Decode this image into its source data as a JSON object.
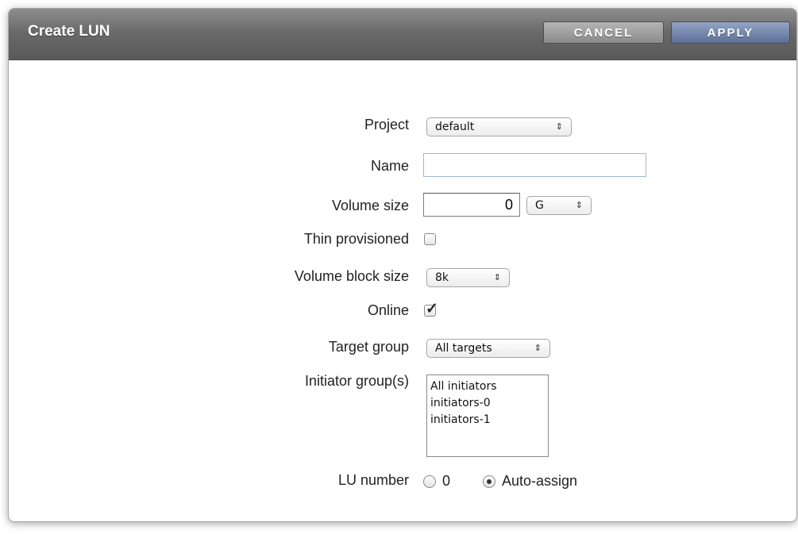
{
  "dialog": {
    "title": "Create LUN",
    "cancel_label": "CANCEL",
    "apply_label": "APPLY"
  },
  "form": {
    "project": {
      "label": "Project",
      "value": "default"
    },
    "name": {
      "label": "Name",
      "value": ""
    },
    "volume_size": {
      "label": "Volume size",
      "value": "0",
      "unit": "G"
    },
    "thin_provisioned": {
      "label": "Thin provisioned",
      "checked": false
    },
    "volume_block_size": {
      "label": "Volume block size",
      "value": "8k"
    },
    "online": {
      "label": "Online",
      "checked": true,
      "mark": "✓"
    },
    "target_group": {
      "label": "Target group",
      "value": "All targets"
    },
    "initiator_groups": {
      "label": "Initiator group(s)",
      "options": [
        "All initiators",
        "initiators-0",
        "initiators-1"
      ]
    },
    "lu_number": {
      "label": "LU number",
      "options": [
        {
          "label": "0",
          "selected": false
        },
        {
          "label": "Auto-assign",
          "selected": true
        }
      ]
    }
  },
  "icons": {
    "select_arrow": "⇕"
  }
}
